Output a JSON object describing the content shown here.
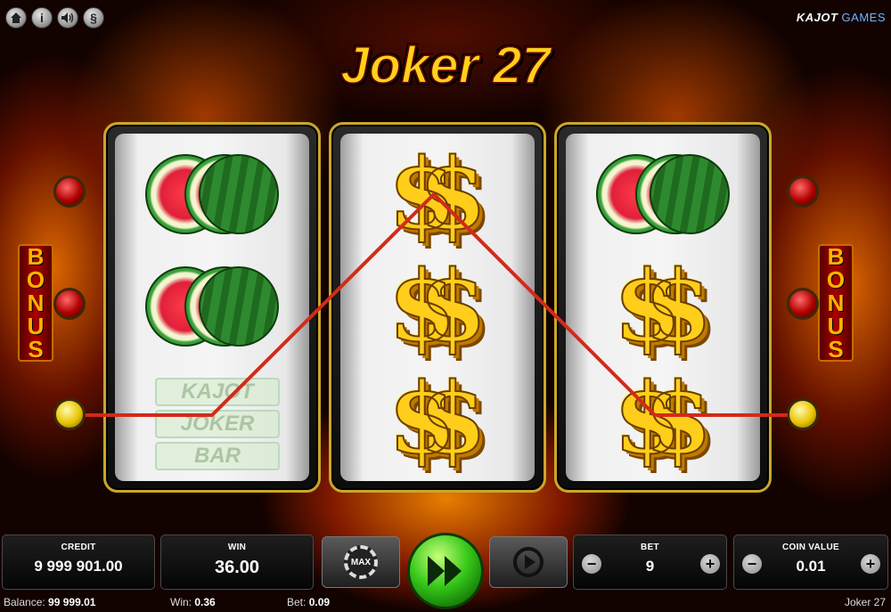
{
  "topbar": {
    "home_icon": "home-icon",
    "info_label": "i",
    "sound_icon": "speaker-icon",
    "rules_label": "§",
    "brand_name": "KAJOT",
    "brand_suffix": "GAMES"
  },
  "game": {
    "title": "Joker 27",
    "bonus_label": "BONUS",
    "reels": [
      [
        "melon",
        "melon",
        "ghost"
      ],
      [
        "dollar",
        "dollar",
        "dollar"
      ],
      [
        "melon",
        "dollar",
        "dollar"
      ]
    ],
    "ghost_symbols": [
      "KAJOT",
      "JOKER",
      "BAR"
    ],
    "win_line_color": "#d32a1a"
  },
  "panel": {
    "credit_label": "CREDIT",
    "credit_value": "9 999 901.00",
    "win_label": "WIN",
    "win_value": "36.00",
    "max_label": "MAX",
    "bet_label": "BET",
    "bet_value": "9",
    "coin_label": "COIN VALUE",
    "coin_value": "0.01",
    "minus": "−",
    "plus": "+"
  },
  "status": {
    "balance_label": "Balance:",
    "balance_value": "99 999.01",
    "win_label": "Win:",
    "win_value": "0.36",
    "bet_label": "Bet:",
    "bet_value": "0.09",
    "game_name": "Joker 27"
  }
}
